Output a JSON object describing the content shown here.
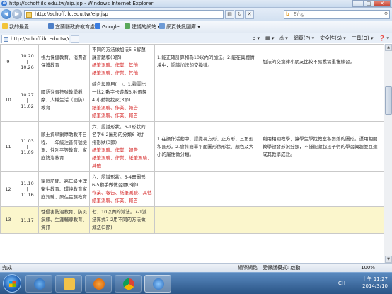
{
  "window": {
    "title": "http://schoff.ilc.edu.tw/eip.jsp - Windows Internet Explorer"
  },
  "address": {
    "url": "http://schoff.ilc.edu.tw/eip.jsp",
    "search_placeholder": "Bing"
  },
  "favorites": {
    "favorites_label": "我的最愛",
    "items": [
      "宜蘭縣政府教育處",
      "Google",
      "建議的網站 ▾",
      "網頁快訊圖庫 ▾"
    ]
  },
  "tab": {
    "label": "http://schoff.ilc.edu.tw/eip.jsp"
  },
  "commands": {
    "page": "網頁(P) ▾",
    "safety": "安全性(S) ▾",
    "tools": "工具(O) ▾",
    "help": "❓ ▾"
  },
  "rows": [
    {
      "no": "9",
      "date_from": "10.20",
      "date_to": "10.26",
      "topic": "視力保健教育、消費者保護教育",
      "content_lines": [
        "不同的方法做加法5-5解題",
        "課習題和(3節)"
      ],
      "assess": [
        "紙筆測驗、作業、其他",
        "紙筆測驗、作業、其他"
      ],
      "goal": "1.能正確計算和為10以內的加法。2.能在具體情境中，認識加法的交換律。",
      "method": "加法的交換律小朋友比較不易悉需重複練習。"
    },
    {
      "no": "10",
      "date_from": "10.27",
      "date_to": "11.02",
      "topic": "國語注音符號教學觀摩、人權生活（國防）教育",
      "content_lines": [
        "綜合與應用(一)、1.看圖比",
        "一比2.數字卡遊戲3.射飛鏢",
        "4.小動物找家(3節)"
      ],
      "assess": [
        "紙筆測驗、作業、報告",
        "紙筆測驗、作業、報告"
      ],
      "goal": "",
      "method": ""
    },
    {
      "no": "11",
      "date_from": "11.03",
      "date_to": "11.09",
      "topic": "順土資學觀摩助教不日程、一年級注音符號檢測、性別平等教育、家庭防治教育",
      "content_lines": [
        "六、認識形狀。6-1形狀的",
        "名字6-2圖形的分類6-3拼",
        "排形狀(3節)"
      ],
      "assess": [
        "紙筆測驗、作業、報告",
        "紙筆測驗、作業、紙筆測驗、其他"
      ],
      "goal": "1.在操作活動中，認識長方形、正方形、三角形和圓形。2.會將簡單平面圖形依形狀、顏色及大小的屬性做分類。",
      "method": "利用相關教學，讓學生學找教室各角落的圖形。運用相關教學啟發形況分類，不僅能激起孩子們的學習興趣並且達成其教學成效。"
    },
    {
      "no": "12",
      "date_from": "11.10",
      "date_to": "11.16",
      "topic": "家庭訪問、高年級生理衛生教育、環境教育家庭測驗、原住民族教育",
      "content_lines": [
        "六、認識形狀。6-4畫圖形",
        "6-5動手做做習題(3節)"
      ],
      "assess": [
        "作業、報告、紙筆測驗、其他",
        "紙筆測驗、作業、報告"
      ],
      "goal": "",
      "method": ""
    },
    {
      "no": "13",
      "date_from": "11.17",
      "date_to": "",
      "topic": "性侵害防治教育、防災演練、生涯輔導教育、資訊",
      "content_lines": [
        "七、10以內的減法。7-1減",
        "法算式7-2用不同的方法做",
        "減法(3節)"
      ],
      "assess": [],
      "goal": "",
      "method": ""
    }
  ],
  "status": {
    "left": "完成",
    "zone": "網際網路 | 受保護模式: 啟動",
    "zoom": "100%"
  },
  "taskbar": {
    "time": "上午 11:27",
    "date": "2014/3/10",
    "lang": "CH"
  }
}
